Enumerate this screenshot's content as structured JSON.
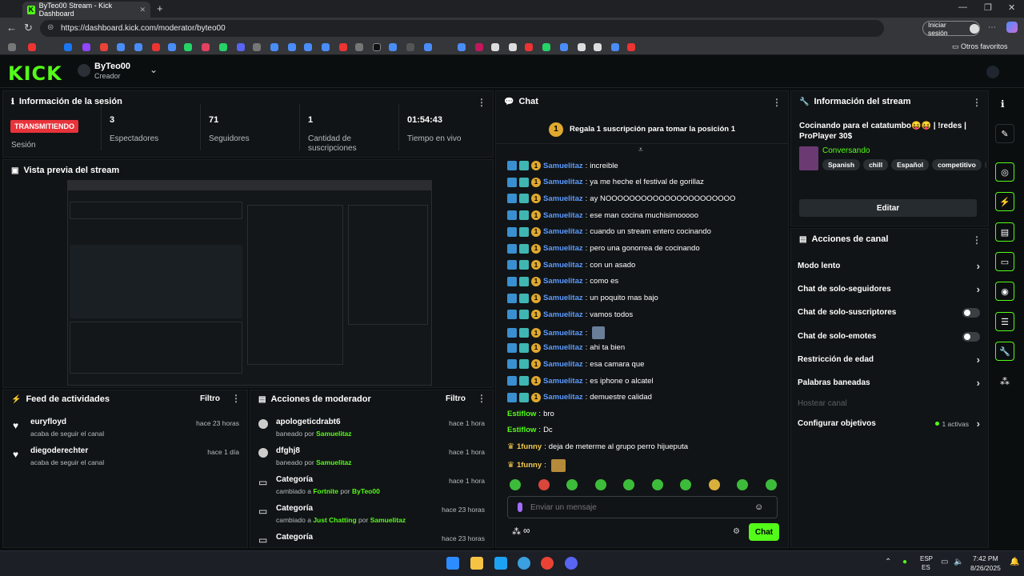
{
  "browser": {
    "tab_title": "ByTeo00 Stream - Kick Dashboard",
    "url": "https://dashboard.kick.com/moderator/byteo00",
    "profile_label": "Iniciar sesión",
    "other_favorites": "Otros favoritos"
  },
  "header": {
    "logo": "KICK",
    "channel_name": "ByTeo00",
    "role": "Creador"
  },
  "session": {
    "title": "Información de la sesión",
    "status_badge": "TRANSMITIENDO",
    "status_label": "Sesión",
    "stats": [
      {
        "value": "3",
        "label": "Espectadores"
      },
      {
        "value": "71",
        "label": "Seguidores"
      },
      {
        "value": "1",
        "label": "Cantidad de suscripciones"
      },
      {
        "value": "01:54:43",
        "label": "Tiempo en vivo"
      }
    ]
  },
  "preview": {
    "title": "Vista previa del stream"
  },
  "feed": {
    "title": "Feed de actividades",
    "filter": "Filtro",
    "items": [
      {
        "user": "euryfloyd",
        "action": "acaba de seguir el canal",
        "time": "hace 23 horas"
      },
      {
        "user": "diegoderechter",
        "action": "acaba de seguir el canal",
        "time": "hace 1 día"
      }
    ]
  },
  "modactions": {
    "title": "Acciones de moderador",
    "filter": "Filtro",
    "items": [
      {
        "title": "apologeticdrabt6",
        "sub": "baneado por",
        "who": "Samuelitaz",
        "time": "hace 1 hora"
      },
      {
        "title": "dfghj8",
        "sub": "baneado por",
        "who": "Samuelitaz",
        "time": "hace 1 hora"
      },
      {
        "title": "Categoría",
        "sub": "cambiado a",
        "target": "Fortnite",
        "por": "por",
        "who": "ByTeo00",
        "time": "hace 1 hora"
      },
      {
        "title": "Categoría",
        "sub": "cambiado a",
        "target": "Just Chatting",
        "por": "por",
        "who": "Samuelitaz",
        "time": "hace 23 horas"
      },
      {
        "title": "Categoría",
        "time": "hace 23 horas"
      }
    ]
  },
  "chat": {
    "title": "Chat",
    "pinned": "Regala 1 suscripción para tomar la posición 1",
    "messages": [
      {
        "user": "Samuelitaz",
        "text": "increible"
      },
      {
        "user": "Samuelitaz",
        "text": "ya me heche el festival de gorillaz"
      },
      {
        "user": "Samuelitaz",
        "text": "ay NOOOOOOOOOOOOOOOOOOOOOO"
      },
      {
        "user": "Samuelitaz",
        "text": "ese man cocina muchisimooooo"
      },
      {
        "user": "Samuelitaz",
        "text": "cuando un stream entero cocinando"
      },
      {
        "user": "Samuelitaz",
        "text": "pero una gonorrea de cocinando"
      },
      {
        "user": "Samuelitaz",
        "text": "con un asado"
      },
      {
        "user": "Samuelitaz",
        "text": "como es"
      },
      {
        "user": "Samuelitaz",
        "text": "un poquito mas bajo"
      },
      {
        "user": "Samuelitaz",
        "text": "vamos todos"
      },
      {
        "user": "Samuelitaz",
        "text": ""
      },
      {
        "user": "Samuelitaz",
        "text": "ahi ta bien"
      },
      {
        "user": "Samuelitaz",
        "text": "esa camara que"
      },
      {
        "user": "Samuelitaz",
        "text": "es iphone o alcatel"
      },
      {
        "user": "Samuelitaz",
        "text": "demuestre calidad"
      }
    ],
    "others": [
      {
        "user": "Estiflow",
        "text": "bro"
      },
      {
        "user": "Estiflow",
        "text": "Dc"
      },
      {
        "user": "1funny",
        "text": "deja de meterme al grupo perro hijueputa"
      },
      {
        "user": "1funny",
        "text": ""
      }
    ],
    "input_placeholder": "Enviar un mensaje",
    "points": "∞",
    "send": "Chat"
  },
  "stream_info": {
    "title": "Información del stream",
    "stream_title": "Cocinando para el catatumbo😝😝 | !redes | ProPlayer 30$",
    "category": "Conversando",
    "tags": [
      "Spanish",
      "chill",
      "Español",
      "competitivo",
      "f"
    ],
    "edit": "Editar"
  },
  "channel_actions": {
    "title": "Acciones de canal",
    "items": [
      {
        "label": "Modo lento",
        "kind": "chevron"
      },
      {
        "label": "Chat de solo-seguidores",
        "kind": "chevron"
      },
      {
        "label": "Chat de solo-suscriptores",
        "kind": "toggle"
      },
      {
        "label": "Chat de solo-emotes",
        "kind": "toggle"
      },
      {
        "label": "Restricción de edad",
        "kind": "chevron"
      },
      {
        "label": "Palabras baneadas",
        "kind": "chevron"
      },
      {
        "label": "Hostear canal",
        "kind": "disabled"
      },
      {
        "label": "Configurar objetivos",
        "kind": "chevron",
        "extra": "1 activas"
      }
    ]
  },
  "taskbar": {
    "lang": "ESP",
    "lang2": "ES",
    "time": "7:42 PM",
    "date": "8/26/2025"
  }
}
